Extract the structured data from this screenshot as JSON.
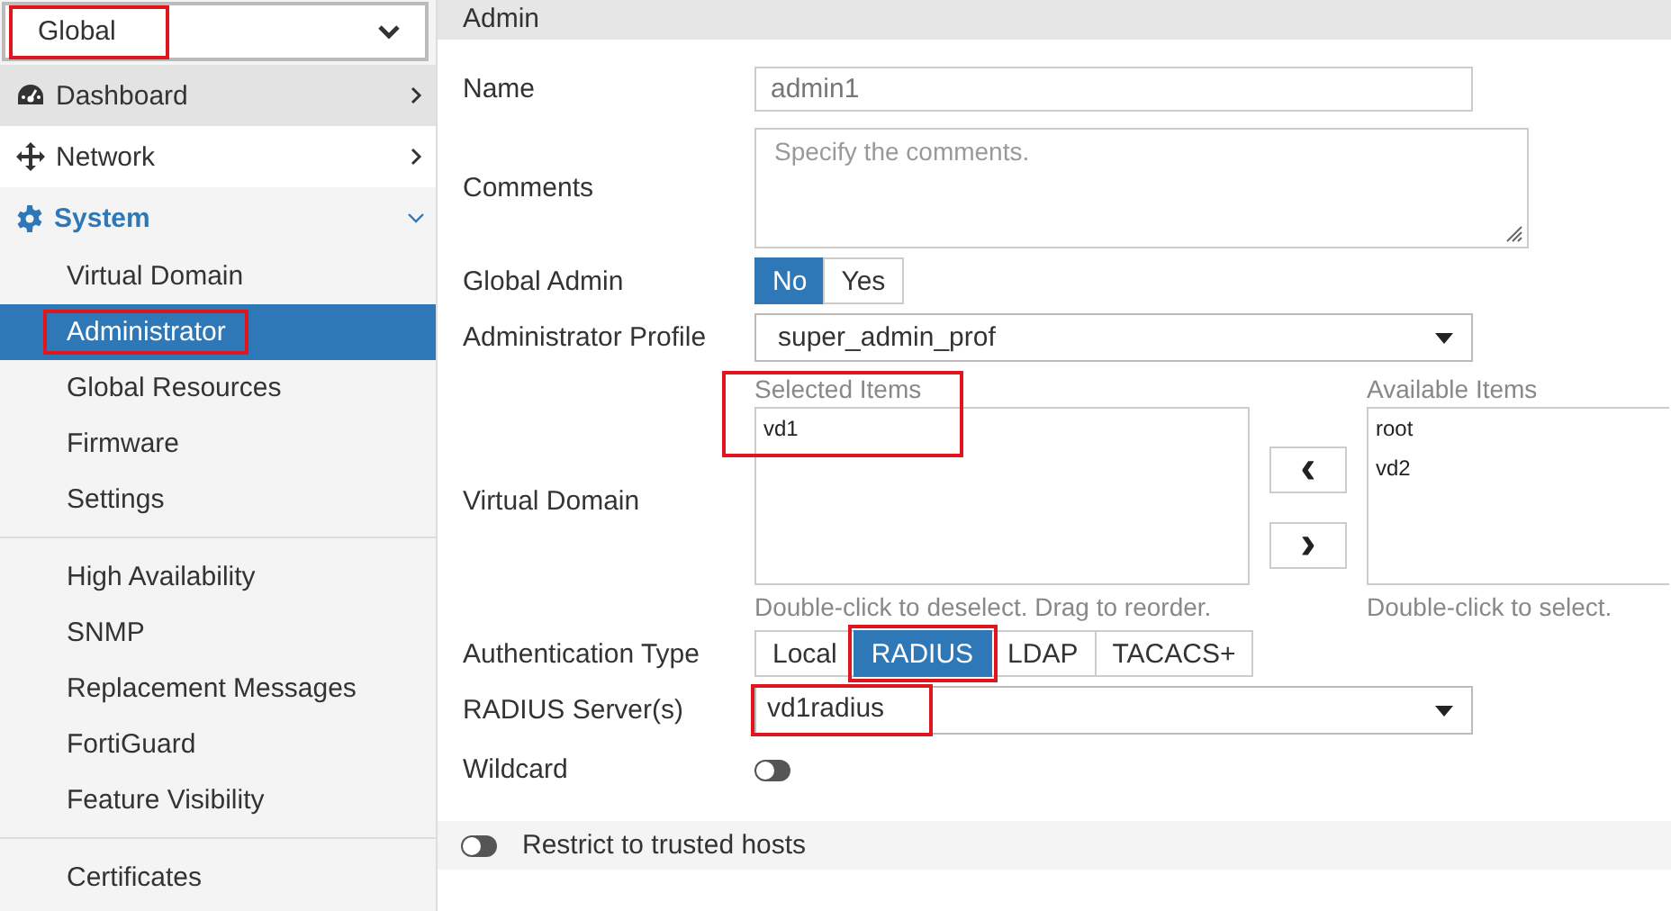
{
  "scope_select": {
    "value": "Global",
    "highlighted": true
  },
  "sidebar": {
    "items": [
      {
        "label": "Dashboard",
        "kind": "dashboard",
        "expanded": false,
        "hovered": true
      },
      {
        "label": "Network",
        "kind": "network",
        "expanded": false,
        "hovered": false
      },
      {
        "label": "System",
        "kind": "settings",
        "expanded": true,
        "hovered": false,
        "children": [
          {
            "kind": "item",
            "label": "Virtual Domain",
            "selected": false,
            "highlighted": false
          },
          {
            "kind": "item",
            "label": "Administrator",
            "selected": true,
            "highlighted": true
          },
          {
            "kind": "item",
            "label": "Global Resources",
            "selected": false,
            "highlighted": false
          },
          {
            "kind": "item",
            "label": "Firmware",
            "selected": false,
            "highlighted": false
          },
          {
            "kind": "item",
            "label": "Settings",
            "selected": false,
            "highlighted": false
          },
          {
            "kind": "separator"
          },
          {
            "kind": "item",
            "label": "High Availability",
            "selected": false,
            "highlighted": false
          },
          {
            "kind": "item",
            "label": "SNMP",
            "selected": false,
            "highlighted": false
          },
          {
            "kind": "item",
            "label": "Replacement Messages",
            "selected": false,
            "highlighted": false
          },
          {
            "kind": "item",
            "label": "FortiGuard",
            "selected": false,
            "highlighted": false
          },
          {
            "kind": "item",
            "label": "Feature Visibility",
            "selected": false,
            "highlighted": false
          },
          {
            "kind": "separator"
          },
          {
            "kind": "item",
            "label": "Certificates",
            "selected": false,
            "highlighted": false
          }
        ]
      }
    ]
  },
  "section_title": "Admin",
  "fields": [
    {
      "kind": "text",
      "label": "Name",
      "value": "admin1",
      "disabled": true
    },
    {
      "kind": "textarea",
      "label": "Comments",
      "placeholder": "Specify the comments."
    },
    {
      "kind": "segmented",
      "label": "Global Admin",
      "options": [
        {
          "label": "No",
          "selected": true,
          "highlighted": false
        },
        {
          "label": "Yes",
          "selected": false,
          "highlighted": false
        }
      ]
    },
    {
      "kind": "select",
      "label": "Administrator Profile",
      "value": "super_admin_prof",
      "highlighted": false
    },
    {
      "kind": "dual_list",
      "label": "Virtual Domain",
      "selected_title": "Selected Items",
      "selected_items": [
        "vd1"
      ],
      "selected_highlighted": true,
      "selected_hint": "Double-click to deselect. Drag to reorder.",
      "move_left": "‹",
      "move_right": "›",
      "available_title": "Available Items",
      "available_items": [
        "root",
        "vd2"
      ],
      "available_hint": "Double-click to select."
    },
    {
      "kind": "segmented",
      "label": "Authentication Type",
      "options": [
        {
          "label": "Local",
          "selected": false,
          "highlighted": false
        },
        {
          "label": "RADIUS",
          "selected": true,
          "highlighted": true
        },
        {
          "label": "LDAP",
          "selected": false,
          "highlighted": false
        },
        {
          "label": "TACACS+",
          "selected": false,
          "highlighted": false
        }
      ]
    },
    {
      "kind": "select",
      "label": "RADIUS Server(s)",
      "value": "vd1radius",
      "highlighted": true
    },
    {
      "kind": "toggle",
      "label": "Wildcard",
      "on": false
    }
  ],
  "trusted_hosts": {
    "label": "Restrict to trusted hosts",
    "on": false
  }
}
